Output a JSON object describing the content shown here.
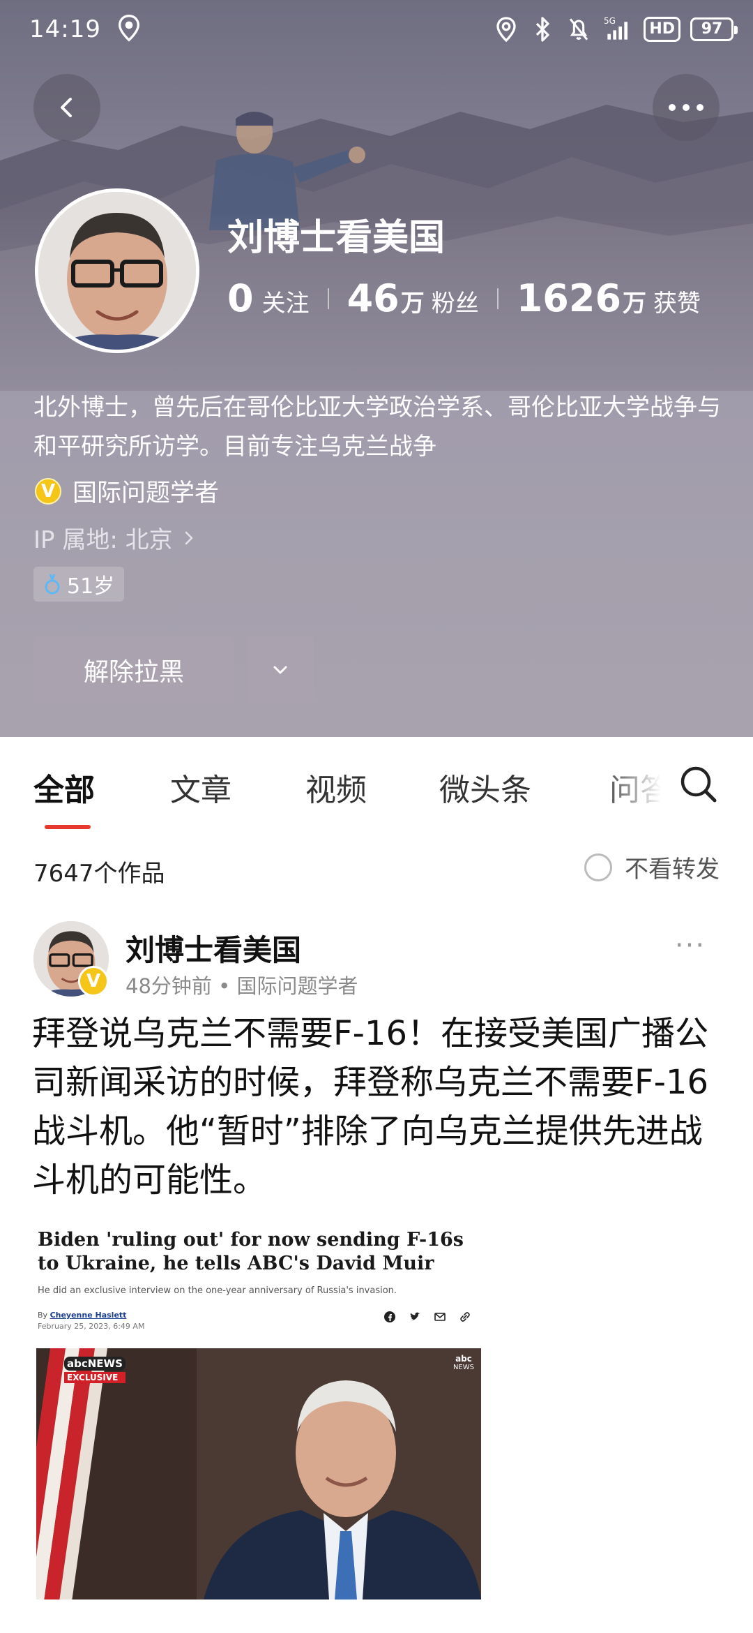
{
  "status_bar": {
    "time": "14:19",
    "network": "5G",
    "hd": "HD",
    "battery": "97"
  },
  "profile": {
    "name": "刘博士看美国",
    "stats": [
      {
        "num": "0",
        "unit": "",
        "label": "关注"
      },
      {
        "num": "46",
        "unit": "万",
        "label": "粉丝"
      },
      {
        "num": "1626",
        "unit": "万",
        "label": "获赞"
      }
    ],
    "bio": "北外博士，曾先后在哥伦比亚大学政治学系、哥伦比亚大学战争与和平研究所访学。目前专注乌克兰战争",
    "verify_badge": "V",
    "verified_title": "国际问题学者",
    "ip_location": "IP 属地: 北京",
    "age": "51岁",
    "unblock_label": "解除拉黑"
  },
  "tabs": [
    {
      "label": "全部",
      "active": true
    },
    {
      "label": "文章",
      "active": false
    },
    {
      "label": "视频",
      "active": false
    },
    {
      "label": "微头条",
      "active": false
    },
    {
      "label": "问答",
      "active": false
    }
  ],
  "works": {
    "count": "7647个作品",
    "hide_repost_label": "不看转发"
  },
  "post": {
    "author": "刘博士看美国",
    "verify_badge": "V",
    "meta": "48分钟前 • 国际问题学者",
    "text": "拜登说乌克兰不需要F-16！在接受美国广播公司新闻采访的时候，拜登称乌克兰不需要F-16战斗机。他“暂时”排除了向乌克兰提供先进战斗机的可能性。",
    "image": {
      "headline": "Biden 'ruling out' for now sending F-16s to Ukraine, he tells ABC's David Muir",
      "subheadline": "He did an exclusive interview on the one-year anniversary of Russia's invasion.",
      "byline_prefix": "By",
      "byline_author": "Cheyenne Haslett",
      "date": "February 25, 2023, 6:49 AM",
      "video_logo": "abcNEWS",
      "video_tag": "EXCLUSIVE",
      "video_corner_logo": "abc",
      "video_corner_text": "NEWS"
    }
  },
  "colors": {
    "accent_red": "#e8392f",
    "verify_gold": "#f5c518"
  }
}
